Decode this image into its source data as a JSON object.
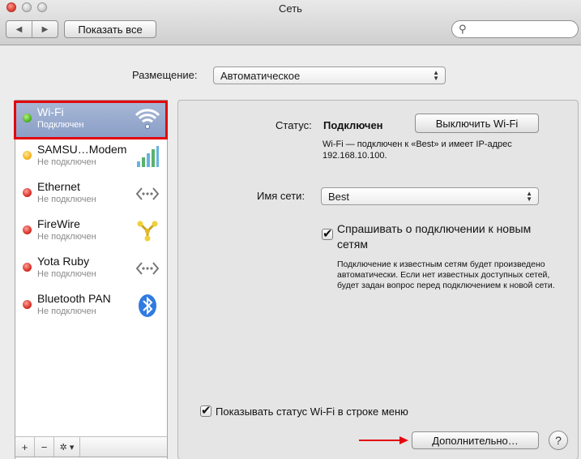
{
  "window": {
    "title": "Сеть"
  },
  "toolbar": {
    "back_glyph": "◀",
    "forward_glyph": "▶",
    "show_all_label": "Показать все",
    "search_value": ""
  },
  "location": {
    "label": "Размещение:",
    "value": "Автоматическое"
  },
  "services": [
    {
      "name": "Wi-Fi",
      "status": "Подключен",
      "state": "green",
      "icon": "wifi-icon",
      "selected": true
    },
    {
      "name": "SAMSU…Modem",
      "status": "Не подключен",
      "state": "yellow",
      "icon": "signal-bars-icon",
      "selected": false
    },
    {
      "name": "Ethernet",
      "status": "Не подключен",
      "state": "red",
      "icon": "ethernet-icon",
      "selected": false
    },
    {
      "name": "FireWire",
      "status": "Не подключен",
      "state": "red",
      "icon": "firewire-icon",
      "selected": false
    },
    {
      "name": "Yota Ruby",
      "status": "Не подключен",
      "state": "red",
      "icon": "ethernet-icon",
      "selected": false
    },
    {
      "name": "Bluetooth PAN",
      "status": "Не подключен",
      "state": "red",
      "icon": "bluetooth-icon",
      "selected": false
    }
  ],
  "sidebar_controls": {
    "add_label": "+",
    "remove_label": "−",
    "gear_label": "✲ ▾"
  },
  "detail": {
    "status_label": "Статус:",
    "status_value": "Подключен",
    "turn_off_label": "Выключить Wi-Fi",
    "status_note": "Wi-Fi — подключен к «Best» и имеет IP-адрес 192.168.10.100.",
    "network_label": "Имя сети:",
    "network_value": "Best",
    "ask_to_join_label": "Спрашивать о подключении к новым сетям",
    "ask_to_join_checked": true,
    "ask_note": "Подключение к известным сетям будет произведено автоматически. Если нет известных доступных сетей, будет задан вопрос перед подключением к новой сети.",
    "show_status_label": "Показывать статус Wi-Fi в строке меню",
    "show_status_checked": true,
    "advanced_label": "Дополнительно…",
    "help_label": "?"
  },
  "colors": {
    "selection": "#8a9ec6",
    "highlight_outline": "#e3060d",
    "arrow": "#e3060d"
  }
}
